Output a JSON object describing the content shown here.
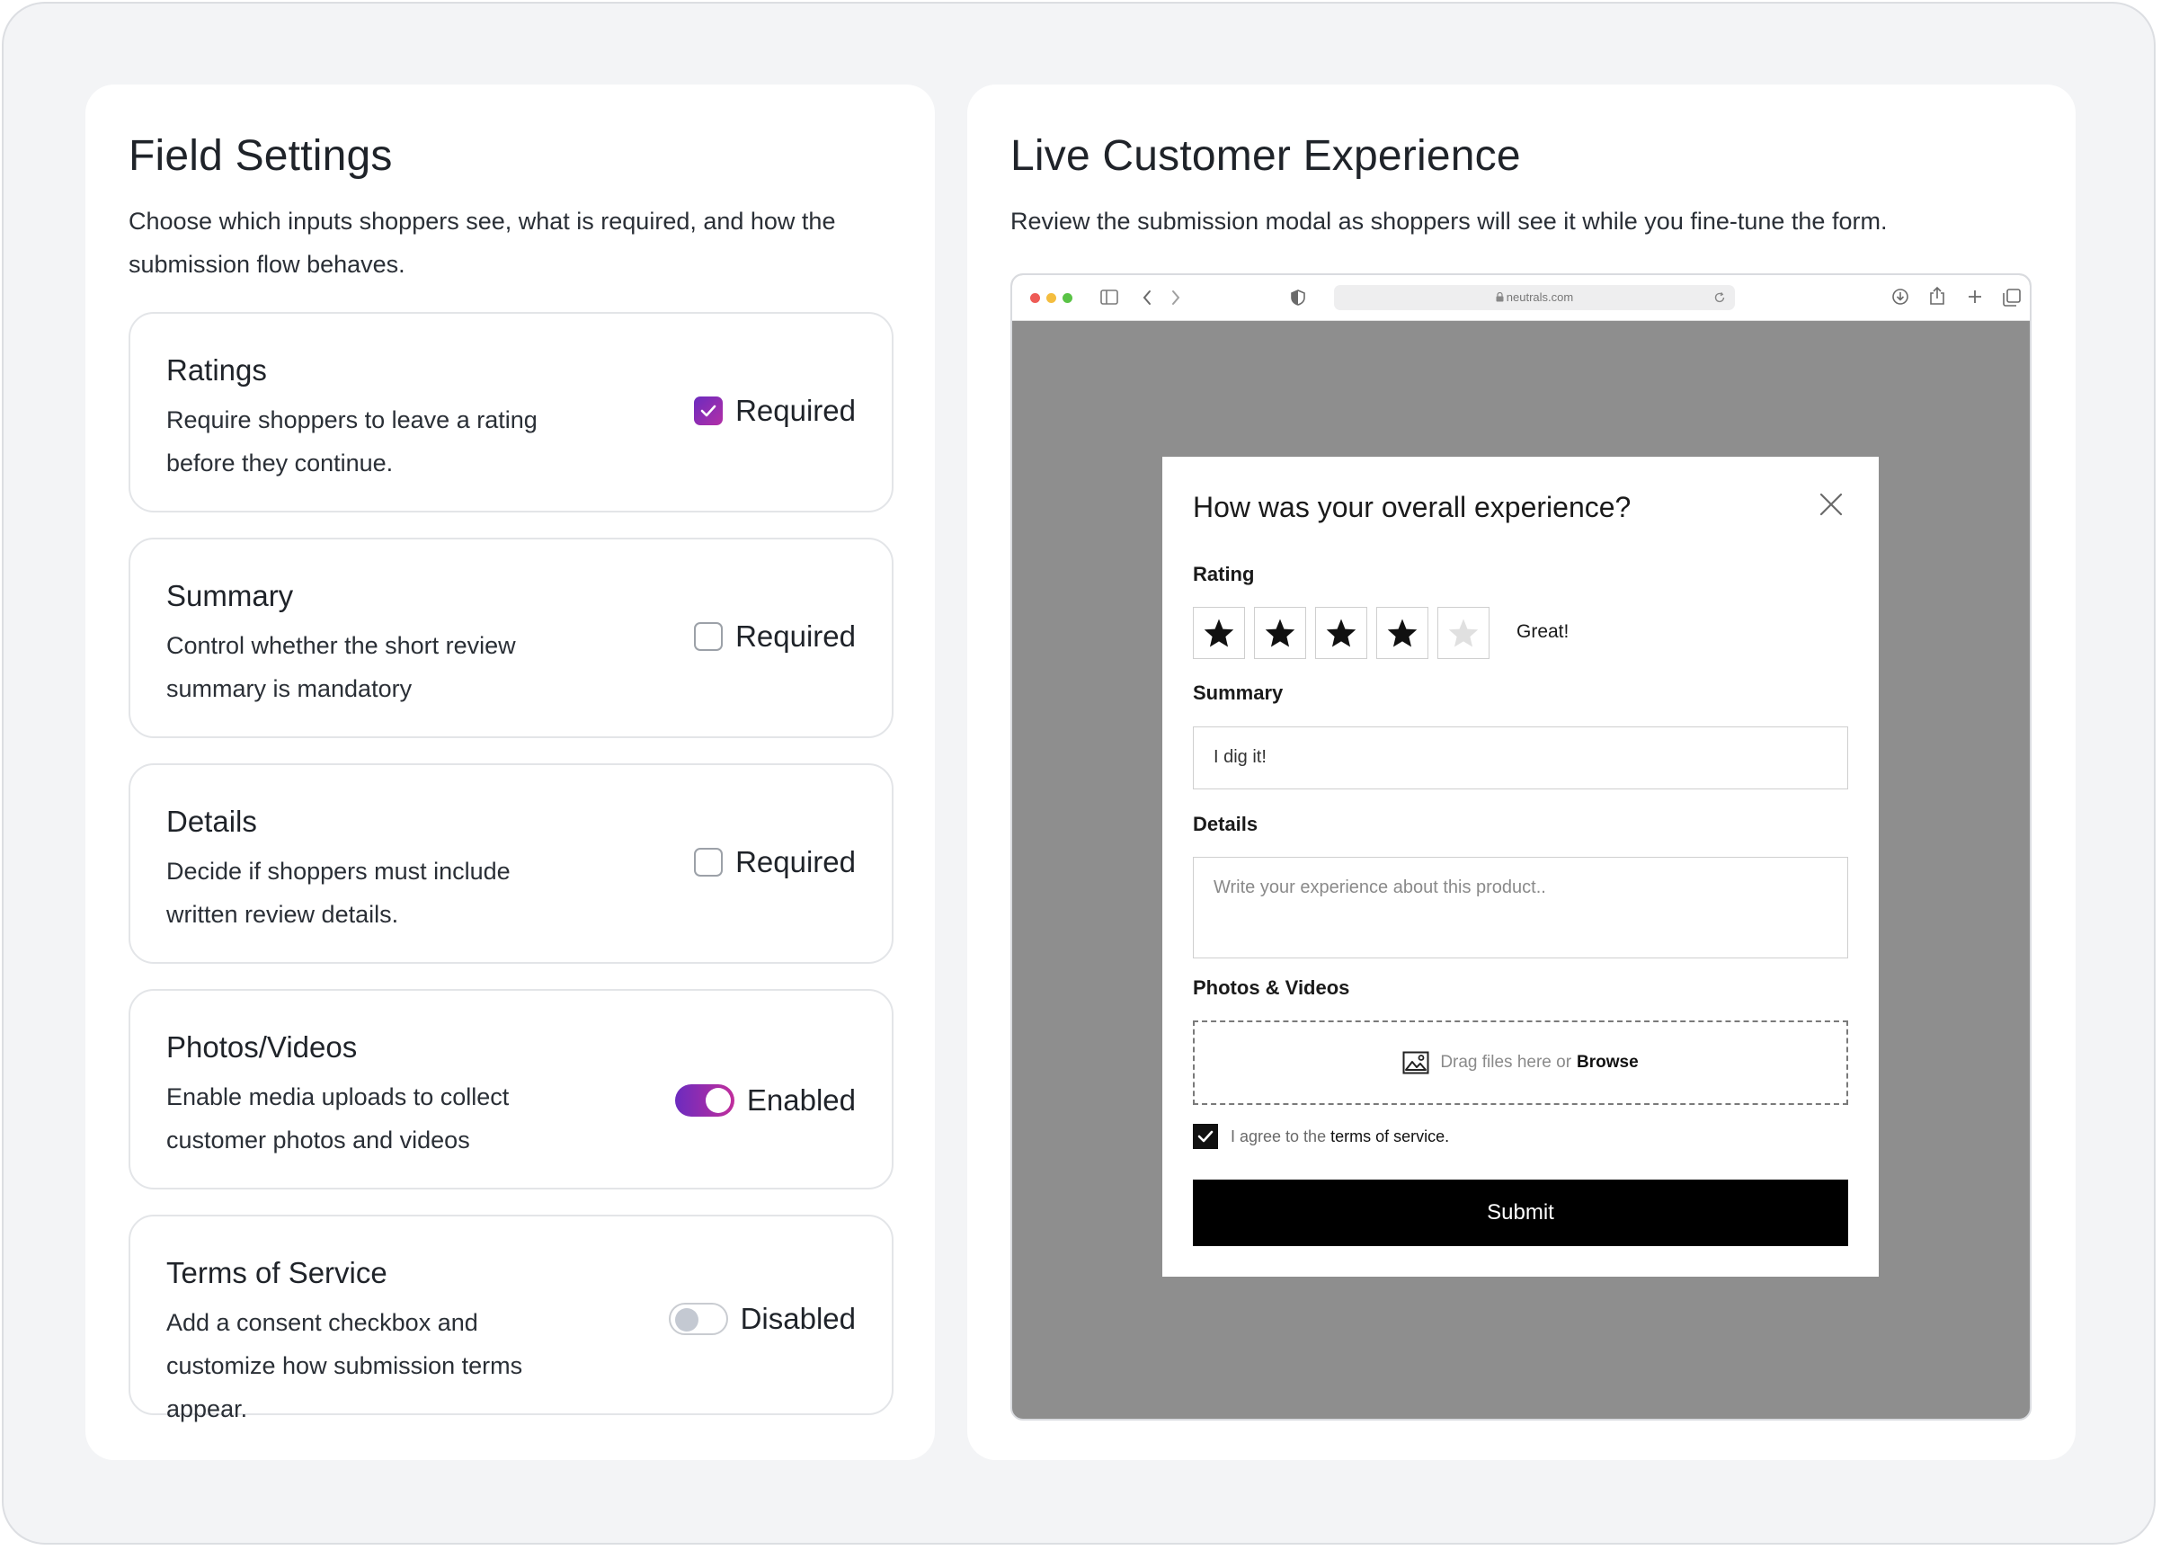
{
  "settings": {
    "title": "Field Settings",
    "subtitle": "Choose which inputs shoppers see, what is required, and how the submission flow behaves.",
    "cards": [
      {
        "title": "Ratings",
        "desc": "Require shoppers to leave a rating before they continue.",
        "control": "checkbox",
        "checked": true,
        "label": "Required"
      },
      {
        "title": "Summary",
        "desc": "Control whether the short review summary is mandatory",
        "control": "checkbox",
        "checked": false,
        "label": "Required"
      },
      {
        "title": "Details",
        "desc": "Decide if shoppers must include written review details.",
        "control": "checkbox",
        "checked": false,
        "label": "Required"
      },
      {
        "title": "Photos/Videos",
        "desc": "Enable media uploads to collect customer photos and videos",
        "control": "toggle",
        "checked": true,
        "label": "Enabled"
      },
      {
        "title": "Terms of Service",
        "desc": "Add a consent checkbox and customize how submission terms appear.",
        "control": "toggle",
        "checked": false,
        "label": "Disabled"
      }
    ]
  },
  "preview": {
    "title": "Live Customer Experience",
    "subtitle": "Review the submission modal as shoppers will see it while you fine-tune the form.",
    "browser": {
      "url": "neutrals.com",
      "dot_colors": [
        "#ee5b56",
        "#f4bd3f",
        "#5ac346"
      ]
    },
    "modal": {
      "title": "How was your overall experience?",
      "rating_label": "Rating",
      "rating_value": 4,
      "rating_max": 5,
      "rating_text": "Great!",
      "summary_label": "Summary",
      "summary_value": "I dig it!",
      "details_label": "Details",
      "details_placeholder": "Write your experience about this product..",
      "media_label": "Photos & Videos",
      "drop_text": "Drag files here or",
      "browse_text": "Browse",
      "agree_text": "I agree to the",
      "agree_link": "terms of service.",
      "agree_checked": true,
      "submit_label": "Submit"
    }
  },
  "colors": {
    "accent_start": "#6b2bbf",
    "accent_end": "#c12e9c",
    "preview_backdrop": "#8e8e8e"
  }
}
